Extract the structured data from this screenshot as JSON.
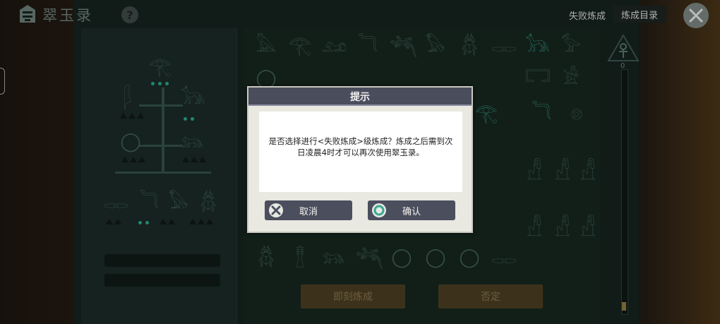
{
  "header": {
    "app_title": "翠玉录",
    "help_icon": "?",
    "failed_refine_label": "失败炼成",
    "catalog_button": "炼成目录"
  },
  "scale": {
    "level_number": "0"
  },
  "actions": {
    "instant_refine": "即刻炼成",
    "deny": "否定"
  },
  "dialog": {
    "title": "提示",
    "message": "是否选择进行<失败炼成>级炼成？炼成之后需到次日凌晨4时才可以再次使用翠玉录。",
    "cancel_label": "取消",
    "confirm_label": "确认"
  },
  "icons": {
    "logo": "sphinx-logo-icon",
    "close": "close-icon",
    "cancel": "cancel-x-icon",
    "confirm": "confirm-circle-icon",
    "ankh": "ankh-icon"
  }
}
